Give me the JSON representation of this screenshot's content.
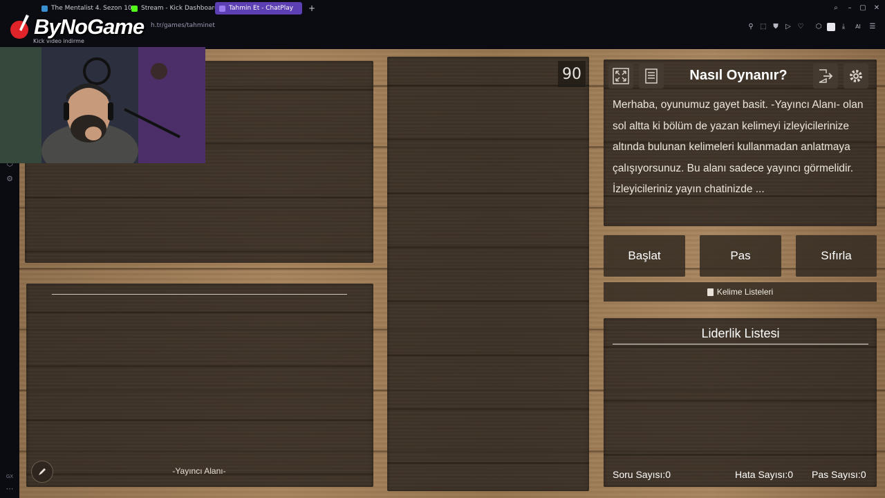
{
  "browser": {
    "tabs": [
      {
        "label": "The Mentalist 4. Sezon 10",
        "active": false
      },
      {
        "label": "Stream - Kick Dashboard",
        "active": false
      },
      {
        "label": "Tahmin Et - ChatPlay",
        "active": true
      }
    ],
    "url": "h.tr/games/tahminet",
    "bookmark": "Kick video indirme",
    "overlay_logo": "ByNoGame",
    "ai_label": "AI",
    "gx_label": "GX"
  },
  "game": {
    "timer": "90",
    "howto": {
      "title": "Nasıl Oynanır?",
      "text": "Merhaba, oyunumuz gayet basit. -Yayıncı Alanı- olan sol altta ki bölüm de yazan kelimeyi izleyicilerinize altında bulunan kelimeleri kullanmadan anlatmaya çalışıyorsunuz. Bu alanı sadece yayıncı görmelidir. İzleyicileriniz yayın chatinizde ..."
    },
    "buttons": {
      "start": "Başlat",
      "pass": "Pas",
      "reset": "Sıfırla"
    },
    "word_lists": "Kelime Listeleri",
    "leaderboard": {
      "title": "Liderlik Listesi"
    },
    "stats": {
      "questions_label": "Soru Sayısı:",
      "questions_value": "0",
      "errors_label": "Hata Sayısı:",
      "errors_value": "0",
      "passes_label": "Pas Sayısı:",
      "passes_value": "0"
    },
    "streamer_area_label": "-Yayıncı Alanı-"
  },
  "colors": {
    "active_tab": "#5b3fb3",
    "panel": "#302821",
    "wood": "#a0805a"
  }
}
